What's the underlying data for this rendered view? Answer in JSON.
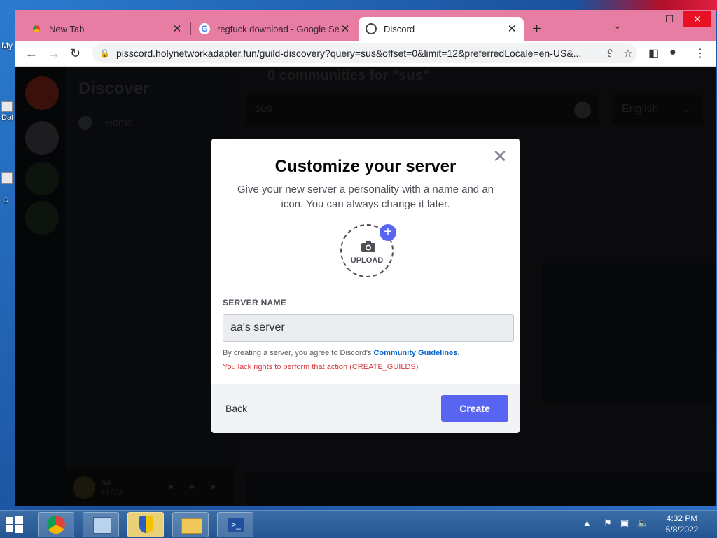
{
  "desktop": {
    "labels": [
      "My",
      "Dat",
      "C"
    ]
  },
  "browser": {
    "tabs": [
      {
        "title": "New Tab",
        "favicon": "chrome-icon"
      },
      {
        "title": "regfuck download - Google Sea",
        "favicon": "google-icon"
      },
      {
        "title": "Discord",
        "favicon": "globe-icon"
      }
    ],
    "new_tab": "+",
    "url": "pisscord.holynetworkadapter.fun/guild-discovery?query=sus&offset=0&limit=12&preferredLocale=en-US&..."
  },
  "page": {
    "discover_title": "Discover",
    "home_label": "Home",
    "results_header": "0 communities for \"sus\"",
    "search_value": "sus",
    "language": "English",
    "user_name": "aa",
    "user_tag": "#6773"
  },
  "modal": {
    "title": "Customize your server",
    "subtitle": "Give your new server a personality with a name and an icon. You can always change it later.",
    "upload_label": "UPLOAD",
    "server_name_label": "SERVER NAME",
    "server_name_value": "aa's server",
    "terms_prefix": "By creating a server, you agree to Discord's",
    "terms_link": "Community Guidelines",
    "terms_suffix": ".",
    "error": "You lack rights to perform that action (CREATE_GUILDS)",
    "back_label": "Back",
    "create_label": "Create"
  },
  "taskbar": {
    "time": "4:32 PM",
    "date": "5/8/2022"
  },
  "colors": {
    "window_frame": "#e77da3",
    "blurple": "#5865f2",
    "error_red": "#da373c"
  }
}
